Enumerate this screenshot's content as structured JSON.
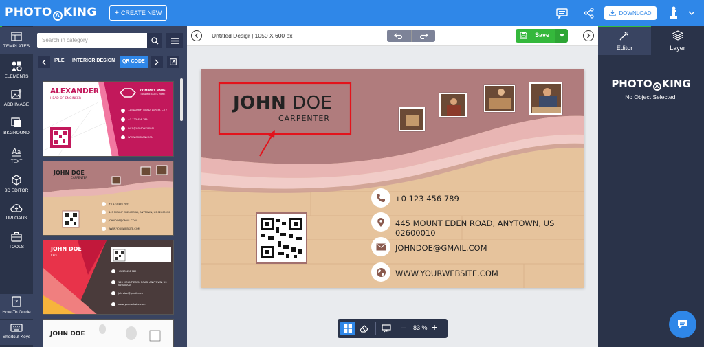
{
  "app": {
    "logo": "PHOTO AD KING",
    "create_label": "CREATE NEW",
    "download_label": "DOWNLOAD"
  },
  "nav": [
    {
      "label": "TEMPLATES",
      "icon": "templates-icon"
    },
    {
      "label": "ELEMENTS",
      "icon": "elements-icon"
    },
    {
      "label": "ADD IMAGE",
      "icon": "add-image-icon"
    },
    {
      "label": "BKGROUND",
      "icon": "background-icon"
    },
    {
      "label": "TEXT",
      "icon": "text-icon"
    },
    {
      "label": "3D EDITOR",
      "icon": "3d-editor-icon"
    },
    {
      "label": "UPLOADS",
      "icon": "uploads-icon"
    },
    {
      "label": "TOOLS",
      "icon": "tools-icon"
    },
    {
      "label": "How-To Guide",
      "icon": "guide-icon"
    },
    {
      "label": "Shortcut Keys",
      "icon": "keyboard-icon"
    }
  ],
  "panel": {
    "search_placeholder": "Search in category",
    "categories": [
      "IPLE",
      "INTERIOR DESIGN",
      "QR CODE"
    ],
    "templates": [
      {
        "name": "ALEXANDER",
        "title": "HEAD OF ENGINEER",
        "company": "COMPANY NAME",
        "tagline": "TAGLINE GOES HERE",
        "address": "123 DUMMY ROAD, LOREM, CITY",
        "phone": "+1 123 456 789",
        "email": "INFO@COMPANY.COM",
        "web": "WWW.COMPANY.COM"
      },
      {
        "name": "JOHN DOE",
        "title": "CARPENTER",
        "phone": "+0 123 456 789",
        "address": "445 MOUNT EDEN ROAD, ANYTOWN, US 02600010",
        "email": "JOHNDOE@GMAIL.COM",
        "web": "WWW.YOURWEBSITE.COM"
      },
      {
        "name": "JOHN DOE",
        "title": "CEO",
        "phone": "+1 23 456 789",
        "address": "123 MOUNT EDEN ROAD, ANYTOWN, US 02600000",
        "email": "johndoe@gmail.com",
        "web": "www.yourwebsite.com"
      },
      {
        "name": "JOHN DOE"
      }
    ]
  },
  "editor": {
    "doc_title": "Untitled Desigr | 1050 X 600 px",
    "save_label": "Save",
    "zoom": "83 %"
  },
  "card": {
    "name_first": "JOHN",
    "name_last": "DOE",
    "title": "CARPENTER",
    "phone": "+0 123 456 789",
    "address": "445 MOUNT EDEN ROAD, ANYTOWN, US 02600010",
    "email": "JOHNDOE@GMAIL.COM",
    "web": "WWW.YOURWEBSITE.COM"
  },
  "right": {
    "tab_editor": "Editor",
    "tab_layer": "Layer",
    "logo": "PHOTO AD KING",
    "status": "No Object Selected."
  },
  "colors": {
    "brand": "#2f87e8",
    "nav": "#2a3349",
    "panel": "#394461",
    "save": "#35b83c",
    "card_top": "#b07c7d",
    "card_wave": "#e8b5b3",
    "wood": "#e6c39c"
  }
}
